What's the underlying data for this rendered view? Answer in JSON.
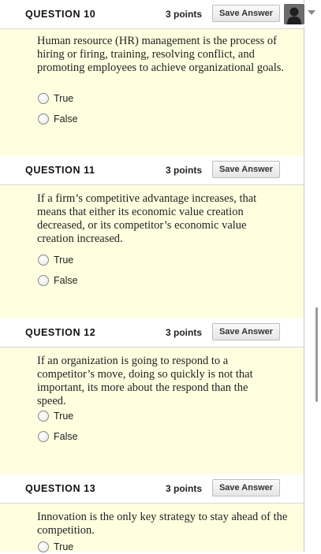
{
  "questions": [
    {
      "title": "QUESTION 10",
      "points": "3 points",
      "save_label": "Save Answer",
      "text": "Human resource (HR) management is the process of hiring or firing, training, resolving conflict, and promoting employees to achieve organizational goals.",
      "options": [
        "True",
        "False"
      ]
    },
    {
      "title": "QUESTION 11",
      "points": "3 points",
      "save_label": "Save Answer",
      "text": "If a firm’s competitive advantage increases, that means that either its economic value creation decreased, or its competitor’s economic value creation increased.",
      "options": [
        "True",
        "False"
      ]
    },
    {
      "title": "QUESTION 12",
      "points": "3 points",
      "save_label": "Save Answer",
      "text": "If an organization is going to respond to a competitor’s move, doing so quickly is not that important, its more about the respond than the speed.",
      "options": [
        "True",
        "False"
      ]
    },
    {
      "title": "QUESTION 13",
      "points": "3 points",
      "save_label": "Save Answer",
      "text": "Innovation is the only key strategy to stay ahead of the competition.",
      "options": [
        "True"
      ]
    }
  ]
}
